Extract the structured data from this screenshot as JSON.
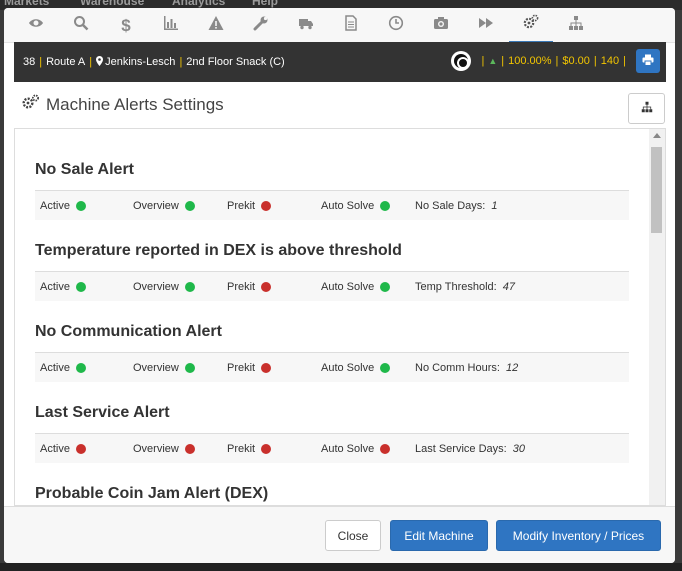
{
  "background_nav": [
    "Markets",
    "Warehouse",
    "Analytics",
    "Help"
  ],
  "tabs": [
    {
      "icon": "eye-icon"
    },
    {
      "icon": "search-icon"
    },
    {
      "icon": "dollar-icon"
    },
    {
      "icon": "bar-chart-icon"
    },
    {
      "icon": "warning-icon"
    },
    {
      "icon": "wrench-icon"
    },
    {
      "icon": "truck-icon"
    },
    {
      "icon": "document-icon"
    },
    {
      "icon": "clock-icon"
    },
    {
      "icon": "camera-icon"
    },
    {
      "icon": "fast-forward-icon"
    },
    {
      "icon": "gears-icon",
      "active": true
    },
    {
      "icon": "sitemap-icon"
    }
  ],
  "info_bar": {
    "machine_id": "38",
    "route": "Route A",
    "location": "Jenkins-Lesch",
    "machine_name": "2nd Floor Snack (C)",
    "percent": "100.00%",
    "amount": "$0.00",
    "count": "140"
  },
  "page": {
    "title": "Machine Alerts Settings"
  },
  "alerts": [
    {
      "title": "No Sale Alert",
      "active": "Active",
      "active_status": "green",
      "overview": "Overview",
      "overview_status": "green",
      "prekit": "Prekit",
      "prekit_status": "red",
      "auto_solve": "Auto Solve",
      "auto_solve_status": "green",
      "param_label": "No Sale Days:",
      "param_value": "1"
    },
    {
      "title": "Temperature reported in DEX is above threshold",
      "active": "Active",
      "active_status": "green",
      "overview": "Overview",
      "overview_status": "green",
      "prekit": "Prekit",
      "prekit_status": "red",
      "auto_solve": "Auto Solve",
      "auto_solve_status": "green",
      "param_label": "Temp Threshold:",
      "param_value": "47"
    },
    {
      "title": "No Communication Alert",
      "active": "Active",
      "active_status": "green",
      "overview": "Overview",
      "overview_status": "green",
      "prekit": "Prekit",
      "prekit_status": "red",
      "auto_solve": "Auto Solve",
      "auto_solve_status": "green",
      "param_label": "No Comm Hours:",
      "param_value": "12"
    },
    {
      "title": "Last Service Alert",
      "active": "Active",
      "active_status": "red",
      "overview": "Overview",
      "overview_status": "red",
      "prekit": "Prekit",
      "prekit_status": "red",
      "auto_solve": "Auto Solve",
      "auto_solve_status": "red",
      "param_label": "Last Service Days:",
      "param_value": "30"
    },
    {
      "title": "Probable Coin Jam Alert (DEX)"
    }
  ],
  "footer": {
    "close_label": "Close",
    "edit_label": "Edit Machine",
    "modify_label": "Modify Inventory / Prices"
  },
  "colors": {
    "green": "#1fb84a",
    "red": "#c9302c",
    "primary": "#2f75c2",
    "accent_yellow": "#f2c500"
  }
}
